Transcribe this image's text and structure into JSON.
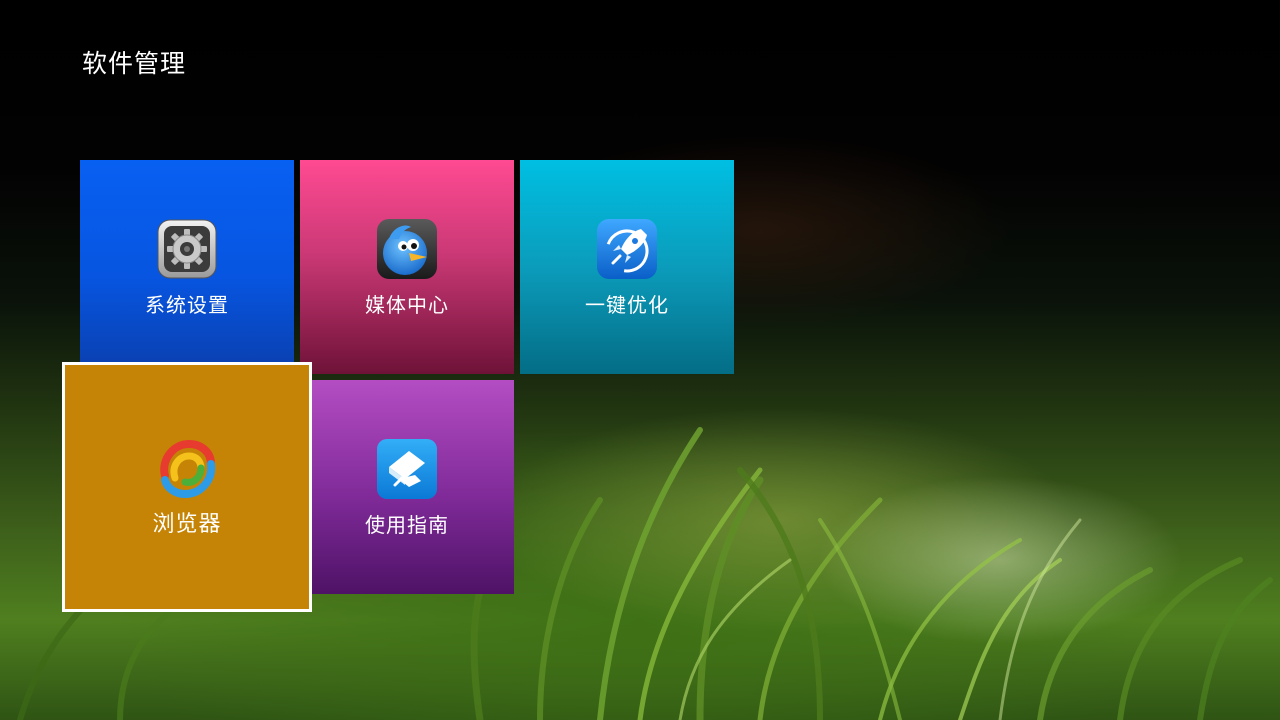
{
  "header": {
    "title": "软件管理"
  },
  "tiles": [
    {
      "label": "系统设置",
      "icon": "gear-icon",
      "color": "#0860f2"
    },
    {
      "label": "媒体中心",
      "icon": "bird-icon",
      "color": "#ff4a92"
    },
    {
      "label": "一键优化",
      "icon": "rocket-icon",
      "color": "#00bfe2"
    },
    {
      "label": "浏览器",
      "icon": "browser-logo-icon",
      "color": "#c58406",
      "focused": true
    },
    {
      "label": "使用指南",
      "icon": "eraser-guide-icon",
      "color": "#b44dc3"
    }
  ]
}
